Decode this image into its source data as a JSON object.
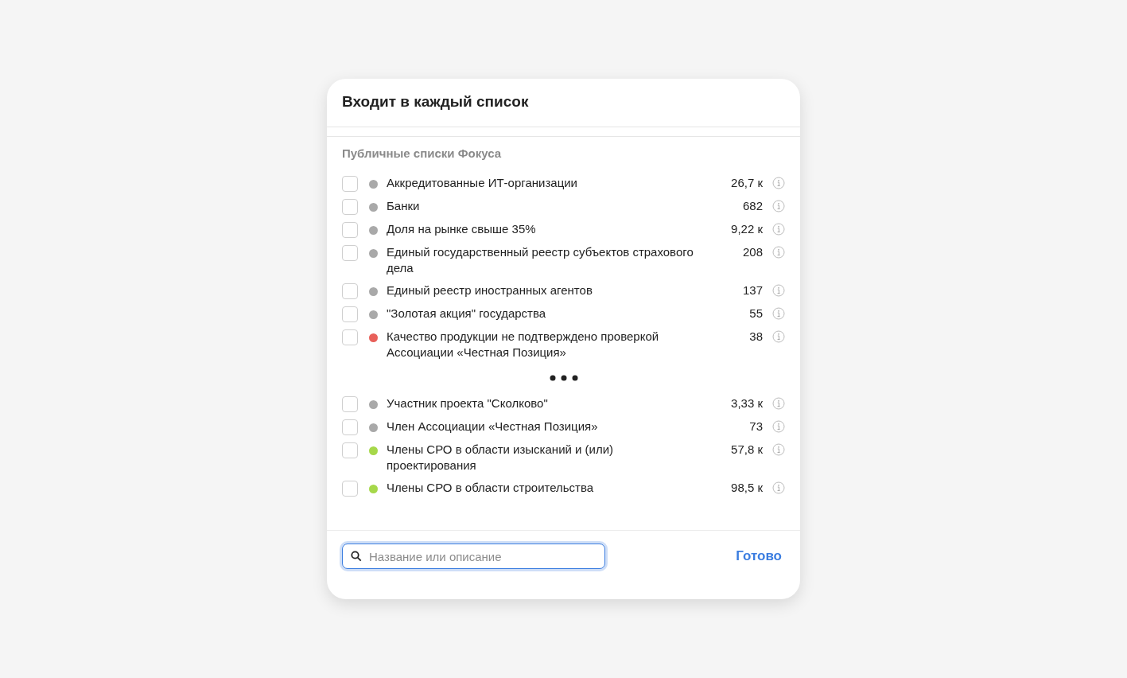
{
  "title": "Входит в каждый список",
  "section": "Публичные списки Фокуса",
  "items": [
    {
      "label": "Аккредитованные ИТ-организации",
      "count": "26,7 к",
      "checked": false,
      "color": "#a9a9a9"
    },
    {
      "label": "Банки",
      "count": "682",
      "checked": false,
      "color": "#a9a9a9"
    },
    {
      "label": "Доля на рынке свыше 35%",
      "count": "9,22 к",
      "checked": false,
      "color": "#a9a9a9"
    },
    {
      "label": "Единый государственный реестр субъектов страхового дела",
      "count": "208",
      "checked": false,
      "color": "#a9a9a9"
    },
    {
      "label": "Единый реестр иностранных агентов",
      "count": "137",
      "checked": false,
      "color": "#a9a9a9"
    },
    {
      "label": "\"Золотая акция\" государства",
      "count": "55",
      "checked": false,
      "color": "#a9a9a9"
    },
    {
      "label": "Качество продукции не подтверждено проверкой Ассоциации «Честная Позиция»",
      "count": "38",
      "checked": false,
      "color": "#e8605a"
    }
  ],
  "more_items": [
    {
      "label": "Участник проекта \"Сколково\"",
      "count": "3,33 к",
      "checked": false,
      "color": "#a9a9a9"
    },
    {
      "label": "Член Ассоциации «Честная Позиция»",
      "count": "73",
      "checked": false,
      "color": "#a9a9a9"
    },
    {
      "label": "Члены СРО в области изысканий и (или) проектирования",
      "count": "57,8 к",
      "checked": false,
      "color": "#a6d84a"
    },
    {
      "label": "Члены СРО в области строительства",
      "count": "98,5 к",
      "checked": false,
      "color": "#a6d84a"
    }
  ],
  "search": {
    "placeholder": "Название или описание"
  },
  "done_button": "Готово"
}
